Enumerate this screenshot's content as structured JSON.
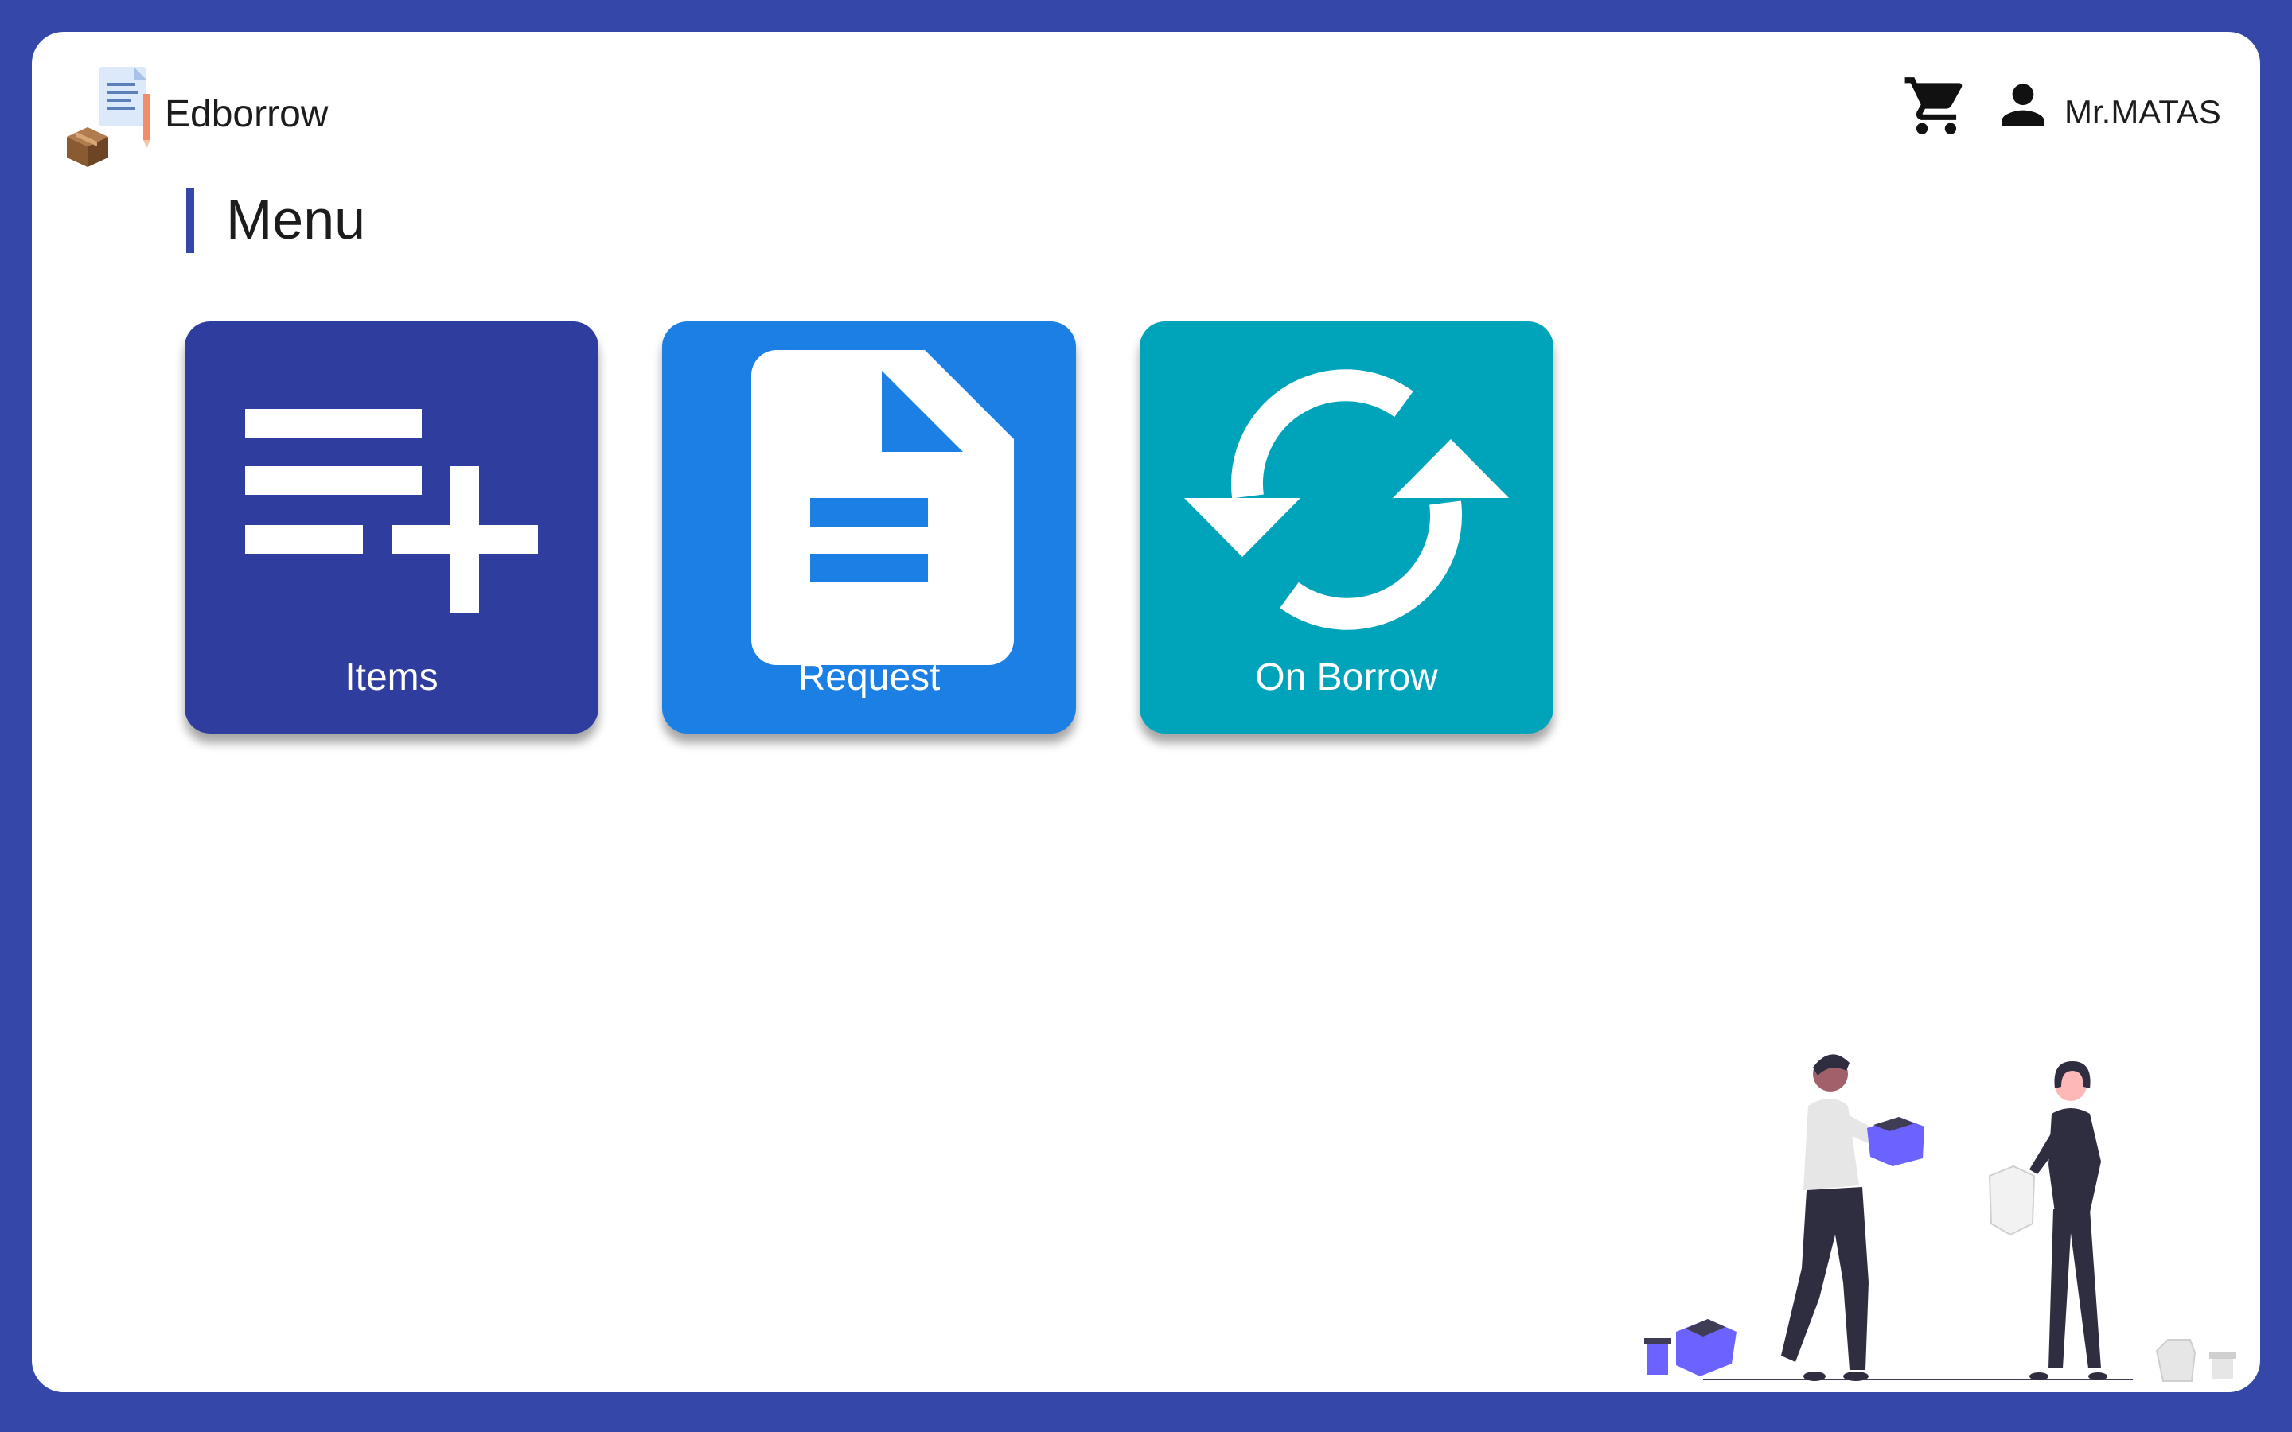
{
  "app": {
    "name": "Edborrow",
    "logo_icon": "document-box-pencil-icon"
  },
  "header": {
    "cart_icon": "cart-icon",
    "user_icon": "user-icon",
    "user_name": "Mr.MATAS"
  },
  "page": {
    "title": "Menu"
  },
  "menu": {
    "cards": [
      {
        "label": "Items",
        "icon": "playlist-add-icon",
        "color": "#2f3e9e"
      },
      {
        "label": "Request",
        "icon": "document-icon",
        "color": "#1c7fe3"
      },
      {
        "label": "On Borrow",
        "icon": "sync-icon",
        "color": "#00a4ba"
      }
    ]
  },
  "colors": {
    "frame": "#3547a9",
    "accent": "#3547a9",
    "illustration_accent": "#6c63ff"
  }
}
